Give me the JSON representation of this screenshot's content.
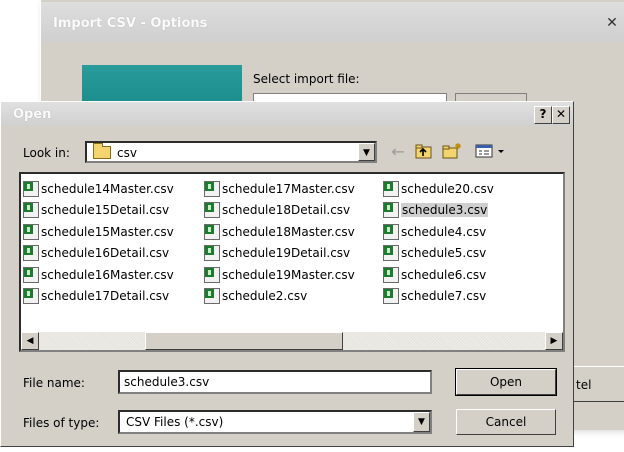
{
  "bg_window": {
    "title": "Import CSV - Options",
    "close": "✕",
    "select_label": "Select import file:",
    "cancel_partial": "tel"
  },
  "dialog": {
    "title": "Open",
    "help": "?",
    "close": "✕",
    "look_in_label": "Look in:",
    "look_in_value": "csv",
    "back_glyph": "←",
    "files": [
      [
        "schedule14Master.csv",
        "schedule15Detail.csv",
        "schedule15Master.csv",
        "schedule16Detail.csv",
        "schedule16Master.csv",
        "schedule17Detail.csv"
      ],
      [
        "schedule17Master.csv",
        "schedule18Detail.csv",
        "schedule18Master.csv",
        "schedule19Detail.csv",
        "schedule19Master.csv",
        "schedule2.csv"
      ],
      [
        "schedule20.csv",
        "schedule3.csv",
        "schedule4.csv",
        "schedule5.csv",
        "schedule6.csv",
        "schedule7.csv"
      ]
    ],
    "selected": "schedule3.csv",
    "file_name_label": "File name:",
    "file_name_value": "schedule3.csv",
    "files_of_type_label": "Files of type:",
    "files_of_type_value": "CSV Files (*.csv)",
    "open_button": "Open",
    "cancel_button": "Cancel"
  }
}
